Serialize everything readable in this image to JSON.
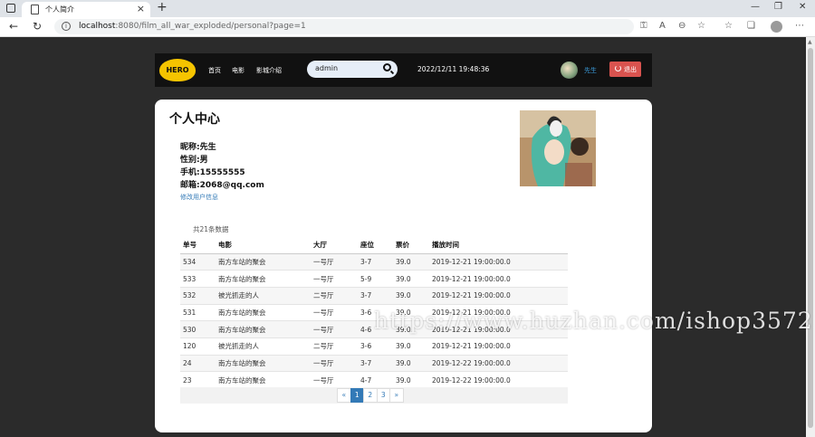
{
  "browser": {
    "tab_title": "个人简介",
    "url_host": "localhost",
    "url_rest": ":8080/film_all_war_exploded/personal?page=1"
  },
  "navbar": {
    "logo_text": "HERO",
    "links": [
      "首页",
      "电影",
      "影城介绍"
    ],
    "search_value": "admin",
    "datetime": "2022/12/11 19:48:36",
    "username": "先生",
    "logout_label": "退出"
  },
  "profile": {
    "heading": "个人中心",
    "nickname": "昵称:先生",
    "gender": "性别:男",
    "phone": "手机:15555555",
    "email": "邮箱:2068@qq.com",
    "edit_link": "修改用户信息"
  },
  "orders": {
    "count_text": "共21条数据",
    "headers": [
      "单号",
      "电影",
      "大厅",
      "座位",
      "票价",
      "播放时间"
    ],
    "rows": [
      [
        "534",
        "南方车站的聚会",
        "一号厅",
        "3-7",
        "39.0",
        "2019-12-21 19:00:00.0"
      ],
      [
        "533",
        "南方车站的聚会",
        "一号厅",
        "5-9",
        "39.0",
        "2019-12-21 19:00:00.0"
      ],
      [
        "532",
        "被光抓走的人",
        "二号厅",
        "3-7",
        "39.0",
        "2019-12-21 19:00:00.0"
      ],
      [
        "531",
        "南方车站的聚会",
        "一号厅",
        "3-6",
        "39.0",
        "2019-12-21 19:00:00.0"
      ],
      [
        "530",
        "南方车站的聚会",
        "一号厅",
        "4-6",
        "39.0",
        "2019-12-21 19:00:00.0"
      ],
      [
        "120",
        "被光抓走的人",
        "二号厅",
        "3-6",
        "39.0",
        "2019-12-21 19:00:00.0"
      ],
      [
        "24",
        "南方车站的聚会",
        "一号厅",
        "3-7",
        "39.0",
        "2019-12-22 19:00:00.0"
      ],
      [
        "23",
        "南方车站的聚会",
        "一号厅",
        "4-7",
        "39.0",
        "2019-12-22 19:00:00.0"
      ]
    ]
  },
  "pagination": {
    "prev": "«",
    "pages": [
      "1",
      "2",
      "3"
    ],
    "next": "»",
    "active_page": "1"
  },
  "watermark": "https://www.huzhan.com/ishop3572",
  "colors": {
    "logout": "#d9534f",
    "link": "#337ab7",
    "logo": "#f5c400",
    "navbar": "#111111"
  }
}
